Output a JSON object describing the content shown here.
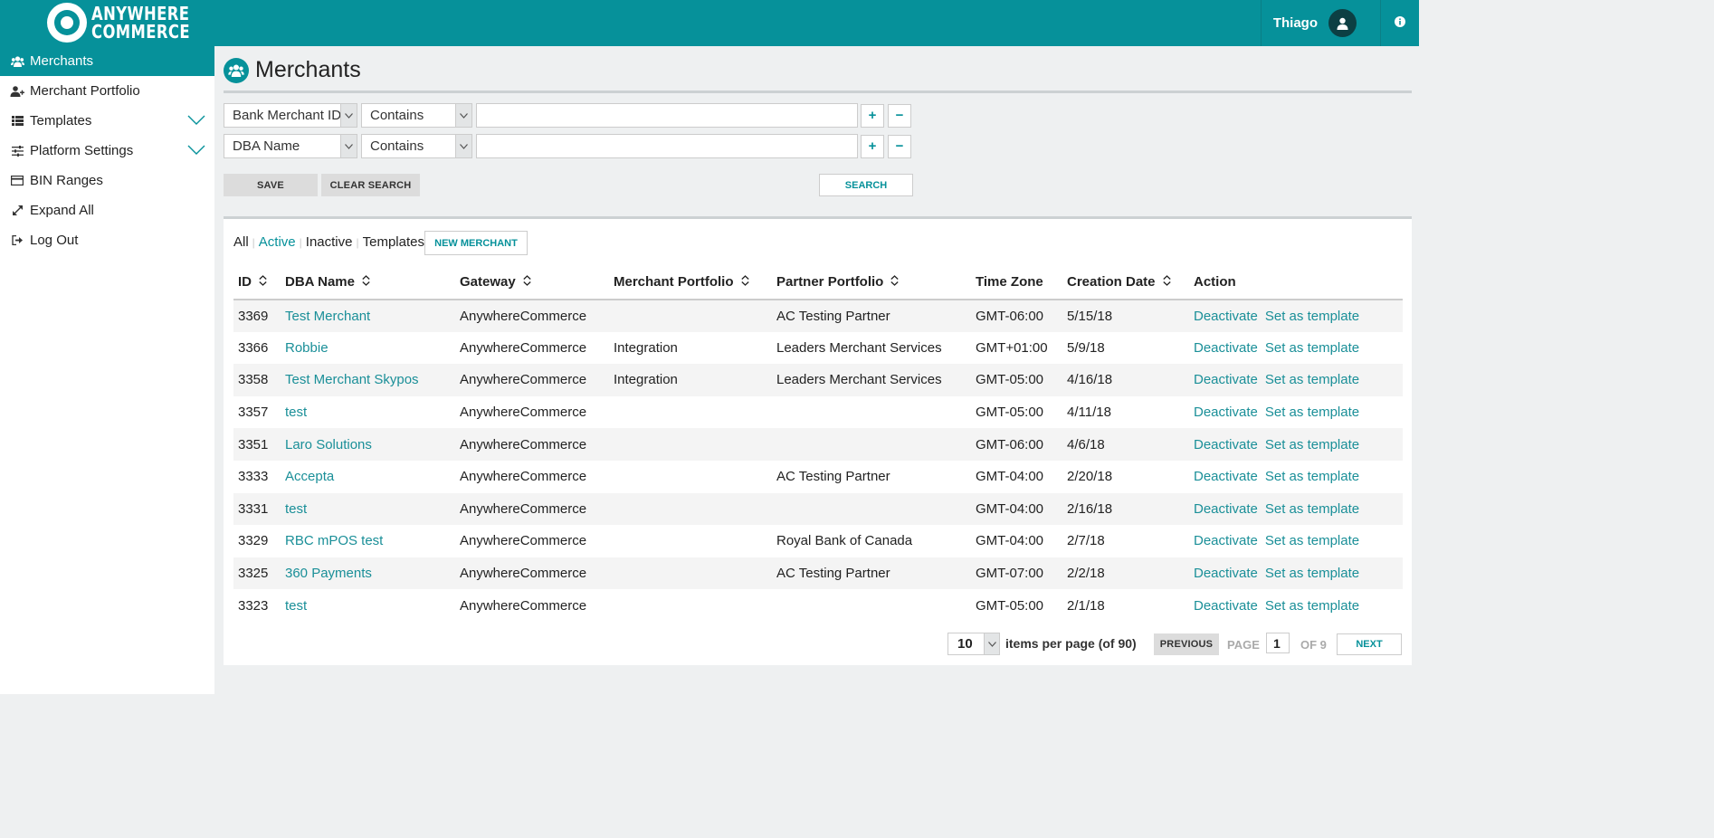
{
  "header": {
    "logo_line1": "ANYWHERE",
    "logo_line2": "COMMERCE",
    "user_name": "Thiago",
    "icons": [
      "user-icon",
      "info-icon"
    ]
  },
  "sidebar": {
    "items": [
      {
        "label": "Merchants",
        "icon": "users-icon"
      },
      {
        "label": "Merchant Portfolio",
        "icon": "user-plus-icon"
      },
      {
        "label": "Templates",
        "icon": "list-icon"
      },
      {
        "label": "Platform Settings",
        "icon": "sliders-icon"
      },
      {
        "label": "BIN Ranges",
        "icon": "credit-card-icon"
      },
      {
        "label": "Expand All",
        "icon": "expand-icon"
      },
      {
        "label": "Log Out",
        "icon": "logout-icon"
      }
    ]
  },
  "page": {
    "title": "Merchants"
  },
  "filters": [
    {
      "field": "Bank Merchant ID",
      "operator": "Contains",
      "value": ""
    },
    {
      "field": "DBA Name",
      "operator": "Contains",
      "value": ""
    }
  ],
  "buttons": {
    "plus": "+",
    "minus": "−",
    "save": "SAVE",
    "clear_search": "CLEAR SEARCH",
    "search": "SEARCH",
    "new_merchant": "NEW MERCHANT"
  },
  "status_tabs": [
    "All",
    "Active",
    "Inactive",
    "Templates"
  ],
  "table": {
    "columns": [
      "ID",
      "DBA Name",
      "Gateway",
      "Merchant Portfolio",
      "Partner Portfolio",
      "Time Zone",
      "Creation Date",
      "Action"
    ],
    "rows": [
      {
        "id": "3369",
        "dba": "Test Merchant",
        "gateway": "AnywhereCommerce",
        "merchant_portfolio": "",
        "partner_portfolio": "AC Testing Partner",
        "tz": "GMT-06:00",
        "date": "5/15/18"
      },
      {
        "id": "3366",
        "dba": "Robbie",
        "gateway": "AnywhereCommerce",
        "merchant_portfolio": "Integration",
        "partner_portfolio": "Leaders Merchant Services",
        "tz": "GMT+01:00",
        "date": "5/9/18"
      },
      {
        "id": "3358",
        "dba": "Test Merchant Skypos",
        "gateway": "AnywhereCommerce",
        "merchant_portfolio": "Integration",
        "partner_portfolio": "Leaders Merchant Services",
        "tz": "GMT-05:00",
        "date": "4/16/18"
      },
      {
        "id": "3357",
        "dba": "test",
        "gateway": "AnywhereCommerce",
        "merchant_portfolio": "",
        "partner_portfolio": "",
        "tz": "GMT-05:00",
        "date": "4/11/18"
      },
      {
        "id": "3351",
        "dba": "Laro Solutions",
        "gateway": "AnywhereCommerce",
        "merchant_portfolio": "",
        "partner_portfolio": "",
        "tz": "GMT-06:00",
        "date": "4/6/18"
      },
      {
        "id": "3333",
        "dba": "Accepta",
        "gateway": "AnywhereCommerce",
        "merchant_portfolio": "",
        "partner_portfolio": "AC Testing Partner",
        "tz": "GMT-04:00",
        "date": "2/20/18"
      },
      {
        "id": "3331",
        "dba": "test",
        "gateway": "AnywhereCommerce",
        "merchant_portfolio": "",
        "partner_portfolio": "",
        "tz": "GMT-04:00",
        "date": "2/16/18"
      },
      {
        "id": "3329",
        "dba": "RBC mPOS test",
        "gateway": "AnywhereCommerce",
        "merchant_portfolio": "",
        "partner_portfolio": "Royal Bank of Canada",
        "tz": "GMT-04:00",
        "date": "2/7/18"
      },
      {
        "id": "3325",
        "dba": "360 Payments",
        "gateway": "AnywhereCommerce",
        "merchant_portfolio": "",
        "partner_portfolio": "AC Testing Partner",
        "tz": "GMT-07:00",
        "date": "2/2/18"
      },
      {
        "id": "3323",
        "dba": "test",
        "gateway": "AnywhereCommerce",
        "merchant_portfolio": "",
        "partner_portfolio": "",
        "tz": "GMT-05:00",
        "date": "2/1/18"
      }
    ],
    "actions": [
      "Deactivate",
      "Set as template"
    ]
  },
  "pagination": {
    "per_page": "10",
    "per_page_label": "items per page (of 90)",
    "previous": "PREVIOUS",
    "page_label": "PAGE",
    "current_page": "1",
    "of_label": "OF 9",
    "next": "NEXT"
  },
  "colors": {
    "brand": "#06919a",
    "link": "#1a8f98",
    "background": "#eef0f1"
  }
}
